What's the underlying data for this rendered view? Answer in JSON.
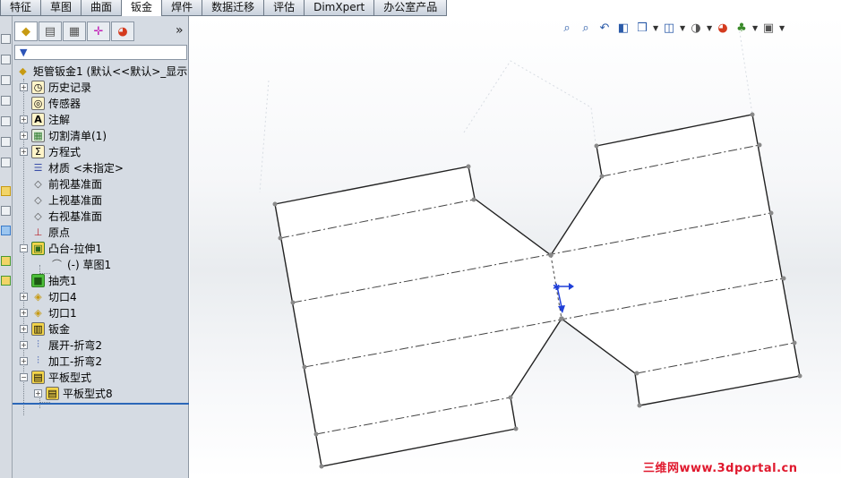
{
  "tabs": [
    "特征",
    "草图",
    "曲面",
    "钣金",
    "焊件",
    "数据迁移",
    "评估",
    "DimXpert",
    "办公室产品"
  ],
  "active_tab": "钣金",
  "panel": {
    "more": "»",
    "tab_icons": [
      "featuremanager-icon",
      "propertymanager-icon",
      "configurationmanager-icon",
      "dimxpert-manager-icon",
      "display-manager-icon"
    ],
    "filter_icon": "filter-icon"
  },
  "tree": {
    "root": "矩管钣金1 (默认<<默认>_显示",
    "items": [
      {
        "label": "历史记录",
        "icon": "history-icon"
      },
      {
        "label": "传感器",
        "icon": "sensor-icon"
      },
      {
        "label": "注解",
        "icon": "annotation-icon"
      },
      {
        "label": "切割清单(1)",
        "icon": "cut-list-icon"
      },
      {
        "label": "方程式",
        "icon": "equation-icon"
      },
      {
        "label": "材质 <未指定>",
        "icon": "material-icon"
      },
      {
        "label": "前视基准面",
        "icon": "plane-icon"
      },
      {
        "label": "上视基准面",
        "icon": "plane-icon"
      },
      {
        "label": "右视基准面",
        "icon": "plane-icon"
      },
      {
        "label": "原点",
        "icon": "origin-icon"
      },
      {
        "label": "凸台-拉伸1",
        "icon": "boss-extrude-icon"
      },
      {
        "label": "(-) 草图1",
        "icon": "sketch-icon"
      },
      {
        "label": "抽壳1",
        "icon": "shell-icon"
      },
      {
        "label": "切口4",
        "icon": "rip-icon"
      },
      {
        "label": "切口1",
        "icon": "rip-icon"
      },
      {
        "label": "钣金",
        "icon": "sheet-metal-icon"
      },
      {
        "label": "展开-折弯2",
        "icon": "unfold-icon"
      },
      {
        "label": "加工-折弯2",
        "icon": "process-bends-icon"
      },
      {
        "label": "平板型式",
        "icon": "flat-pattern-folder-icon"
      },
      {
        "label": "平板型式8",
        "icon": "flat-pattern-icon"
      }
    ]
  },
  "hud_icons": [
    "zoom-to-fit-icon",
    "zoom-to-area-icon",
    "previous-view-icon",
    "section-view-icon",
    "view-orientation-icon",
    "display-style-icon",
    "hide-show-icon",
    "edit-appearance-icon",
    "apply-scene-icon",
    "view-settings-icon"
  ],
  "watermark": "三维网www.3dportal.cn",
  "colors": {
    "accent": "#2b67b8",
    "watermark": "#e0182d",
    "triad": "#1f3fd8"
  }
}
